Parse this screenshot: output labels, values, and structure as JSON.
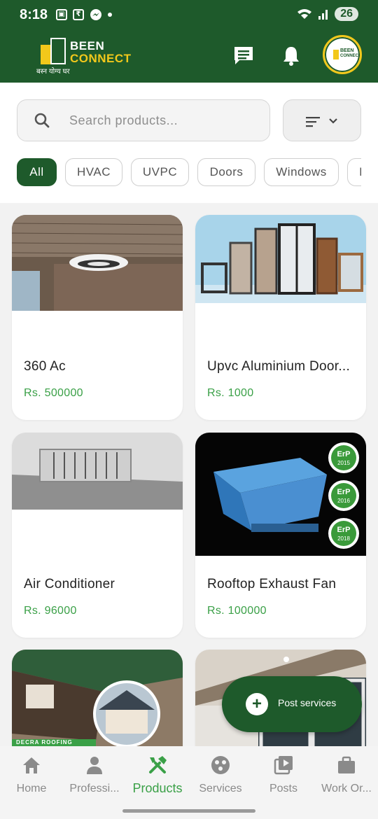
{
  "status_bar": {
    "time": "8:18",
    "battery": "26"
  },
  "header": {
    "logo_line1": "BEEN",
    "logo_line2": "CONNECT",
    "logo_tagline": "बस्न योग्य घर",
    "chat_icon": "chat-icon",
    "bell_icon": "bell-icon"
  },
  "search": {
    "placeholder": "Search products..."
  },
  "categories": [
    "All",
    "HVAC",
    "UVPC",
    "Doors",
    "Windows",
    "I"
  ],
  "products": [
    {
      "name": "360 Ac",
      "price": "Rs. 500000"
    },
    {
      "name": "Upvc Aluminium Door...",
      "price": "Rs. 1000"
    },
    {
      "name": "Air Conditioner",
      "price": "Rs. 96000"
    },
    {
      "name": "Rooftop Exhaust Fan",
      "price": "Rs. 100000",
      "badges": [
        "ErP 2015",
        "ErP 2016",
        "ErP 2018"
      ]
    },
    {
      "banner": "DECRA ROOFING"
    },
    {}
  ],
  "fab": {
    "label": "Post services"
  },
  "nav": [
    {
      "label": "Home",
      "icon": "home-icon"
    },
    {
      "label": "Professi...",
      "icon": "person-icon"
    },
    {
      "label": "Products",
      "icon": "tools-icon",
      "active": true
    },
    {
      "label": "Services",
      "icon": "services-icon"
    },
    {
      "label": "Posts",
      "icon": "posts-icon"
    },
    {
      "label": "Work Or...",
      "icon": "briefcase-icon"
    }
  ],
  "colors": {
    "primary": "#1e5a2b",
    "accent": "#3aa047",
    "brand_yellow": "#f2c81b"
  }
}
